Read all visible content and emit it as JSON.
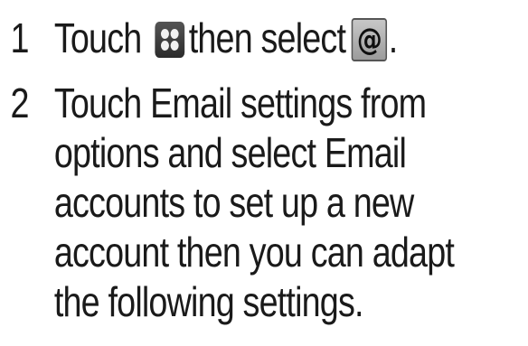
{
  "steps": [
    {
      "number": "1",
      "segments": [
        "Touch",
        "then select",
        "."
      ]
    },
    {
      "number": "2",
      "lines": [
        "Touch Email settings from",
        "options and select",
        "Email",
        "accounts to set up a new",
        "account then you can adapt",
        "the following settings."
      ]
    }
  ],
  "icons": {
    "apps": "apps-grid-icon",
    "email": "email-at-icon",
    "email_glyph": "@"
  }
}
